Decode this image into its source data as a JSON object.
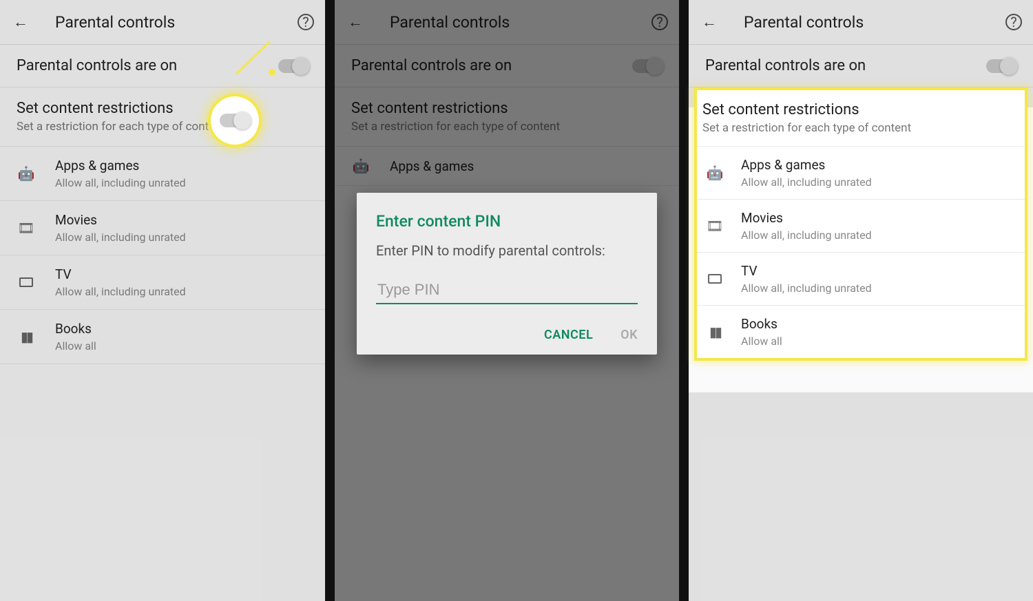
{
  "header": {
    "title": "Parental controls"
  },
  "status": {
    "label": "Parental controls are on"
  },
  "restrictions": {
    "title": "Set content restrictions",
    "subtitle": "Set a restriction for each type of content"
  },
  "items": [
    {
      "label": "Apps & games",
      "sub": "Allow all, including unrated",
      "icon": "android"
    },
    {
      "label": "Movies",
      "sub": "Allow all, including unrated",
      "icon": "movie"
    },
    {
      "label": "TV",
      "sub": "Allow all, including unrated",
      "icon": "tv"
    },
    {
      "label": "Books",
      "sub": "Allow all",
      "icon": "book"
    }
  ],
  "dialog": {
    "title": "Enter content PIN",
    "message": "Enter PIN to modify parental controls:",
    "placeholder": "Type PIN",
    "cancel": "CANCEL",
    "ok": "OK"
  }
}
